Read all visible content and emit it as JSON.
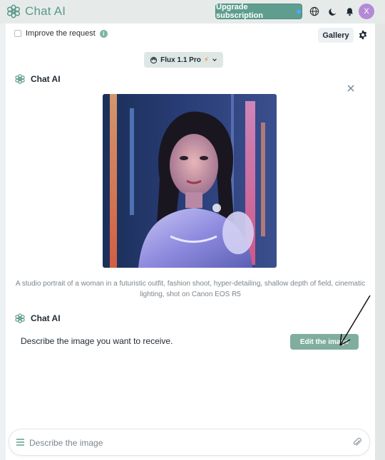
{
  "header": {
    "app_name": "Chat AI",
    "upgrade_label": "Upgrade subscription",
    "avatar_initial": "X",
    "brand_color": "#5a9a8a",
    "icons": [
      "logo-icon",
      "diamond-icon",
      "globe-icon",
      "moon-icon",
      "bell-icon"
    ]
  },
  "toolbar": {
    "improve_label": "Improve the request",
    "improve_checked": false,
    "info_glyph": "i",
    "gallery_label": "Gallery"
  },
  "model_selector": {
    "selected": "Flux 1.1 Pro"
  },
  "conversation": {
    "messages": [
      {
        "author": "Chat AI",
        "type": "image",
        "caption": "A studio portrait of a woman in a futuristic outfit, fashion shoot, hyper-detailing, shallow depth of field, cinematic lighting, shot on Canon EOS R5"
      },
      {
        "author": "Chat AI",
        "type": "text",
        "text": "Describe the image you want to receive.",
        "action_label": "Edit the image"
      }
    ]
  },
  "composer": {
    "placeholder": "Describe the image",
    "value": ""
  },
  "colors": {
    "accent": "#5f9e8e",
    "accent_light": "#7fae9f",
    "avatar": "#b48ad6",
    "bolt": "#f07a2a"
  }
}
